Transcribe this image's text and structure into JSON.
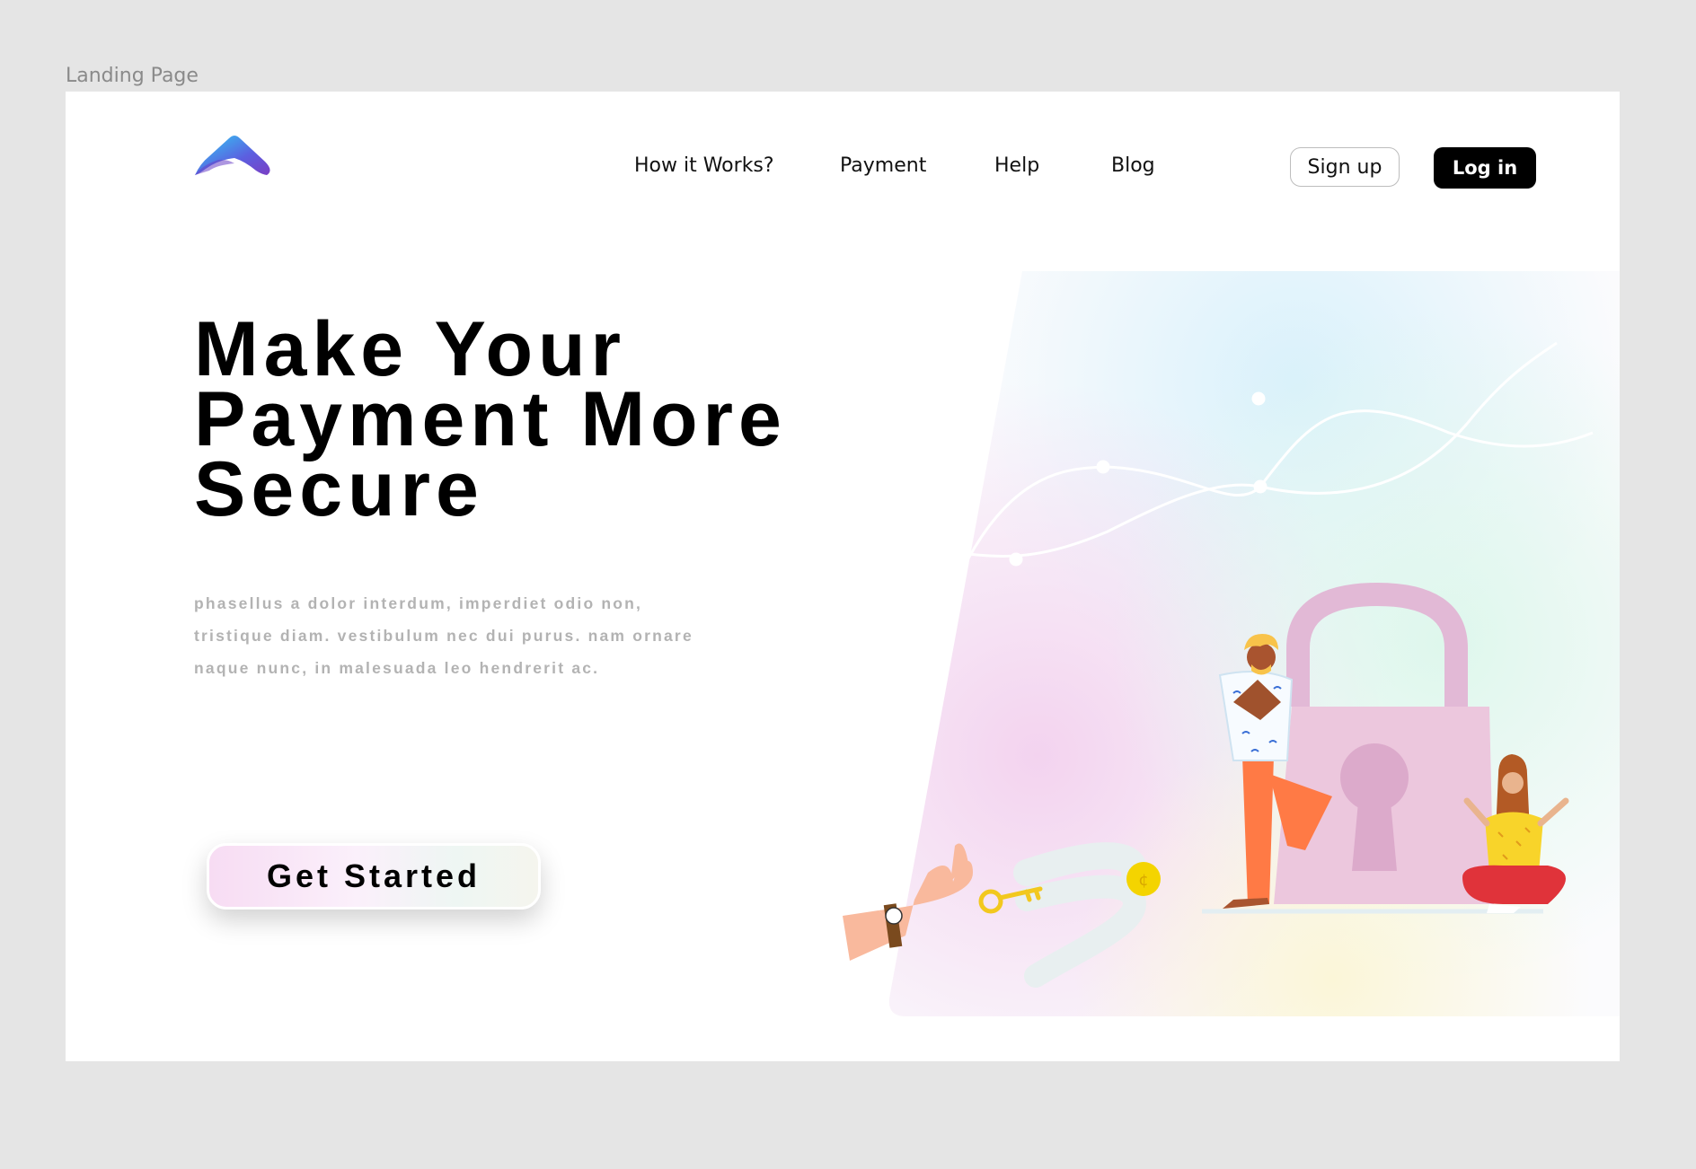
{
  "canvas": {
    "label": "Landing Page"
  },
  "header": {
    "nav": [
      {
        "label": "How it Works?"
      },
      {
        "label": "Payment"
      },
      {
        "label": "Help"
      },
      {
        "label": "Blog"
      }
    ],
    "signup_label": "Sign up",
    "login_label": "Log in"
  },
  "hero": {
    "title_lines": [
      "Make Your",
      "Payment More",
      "Secure"
    ],
    "description_lines": [
      "phasellus a dolor interdum, imperdiet odio non,",
      "tristique diam. vestibulum nec dui purus. nam ornare",
      "naque nunc, in malesuada leo hendrerit ac."
    ],
    "cta_label": "Get Started"
  },
  "colors": {
    "page_background": "#e5e5e5",
    "primary_button": "#000000",
    "logo_gradient": [
      "#2fd0f5",
      "#5b5fe0",
      "#7a3fc4"
    ],
    "padlock": "#e8c6dc",
    "coin": "#f4d400"
  },
  "illustration": {
    "icons": [
      "logo-chevron-icon",
      "padlock-icon",
      "key-icon",
      "coin-icon",
      "network-lines-icon"
    ]
  }
}
